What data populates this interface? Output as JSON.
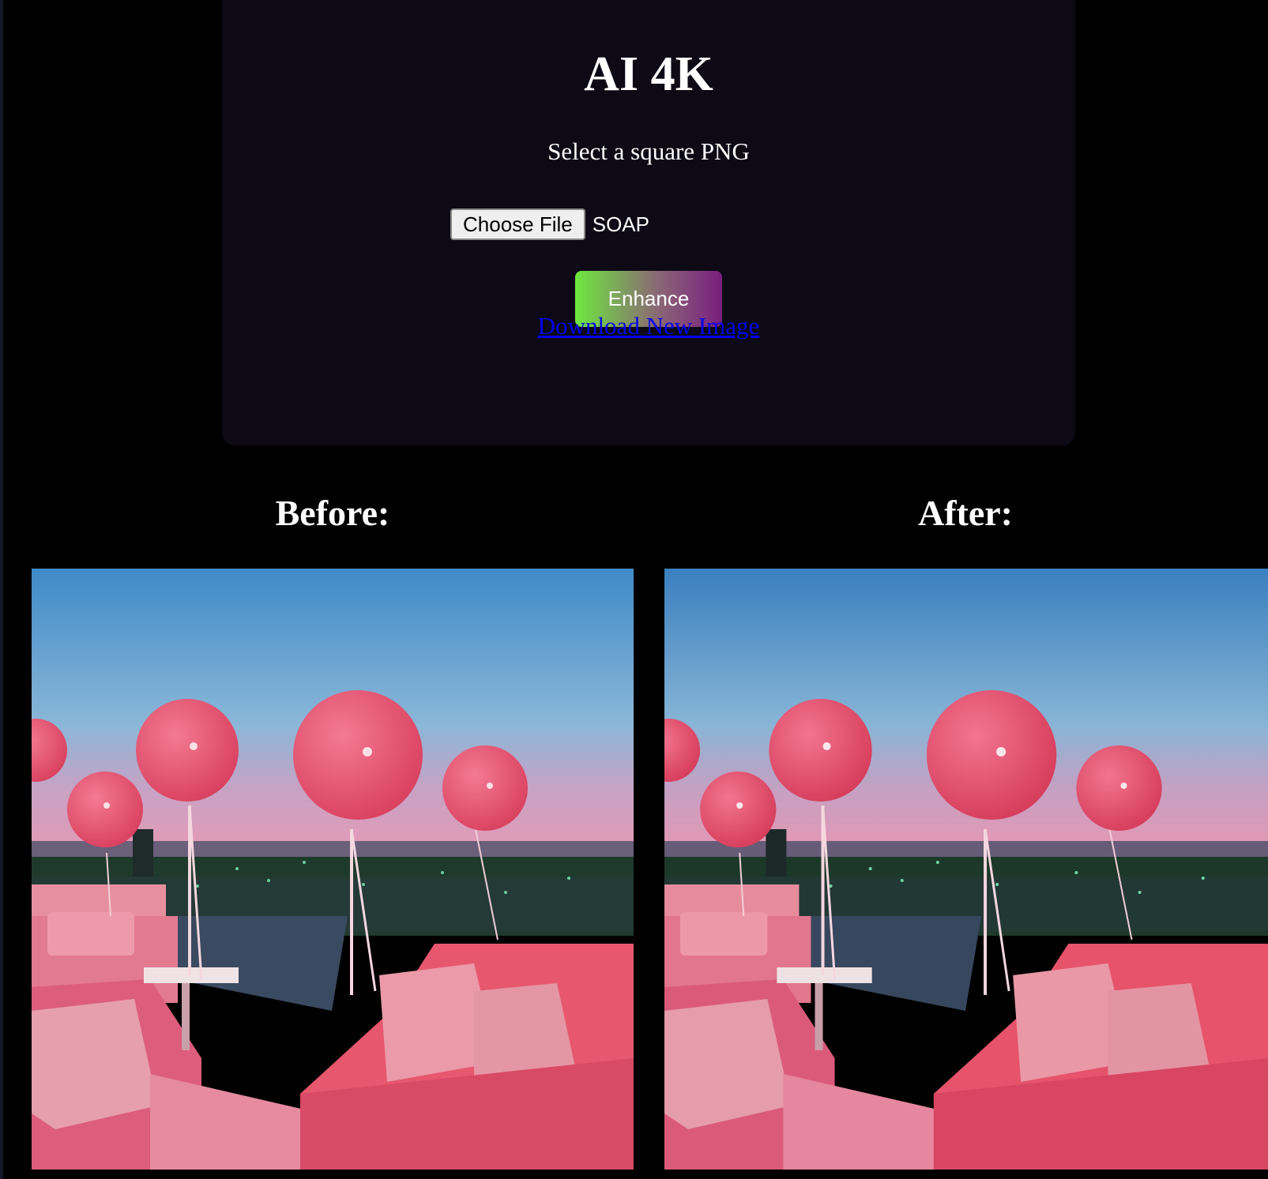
{
  "app": {
    "title": "AI 4K",
    "subtitle": "Select a square PNG"
  },
  "file_input": {
    "button_label": "Choose File",
    "file_name": "SOAP"
  },
  "actions": {
    "enhance_label": "Enhance",
    "download_label": "Download New Image"
  },
  "comparison": {
    "before_heading": "Before:",
    "after_heading": "After:"
  },
  "colors": {
    "page_background": "#000000",
    "panel_background": "#0d0a16",
    "link": "#0000ee",
    "enhance_gradient_start": "#6ee83f",
    "enhance_gradient_end": "#7a1e80"
  }
}
